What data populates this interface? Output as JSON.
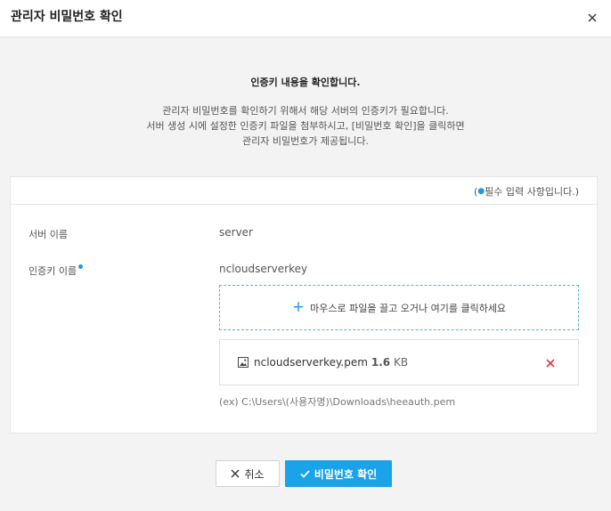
{
  "dialog": {
    "title": "관리자 비밀번호 확인",
    "close_icon": "close-icon"
  },
  "intro": {
    "heading": "인증키 내용을 확인합니다.",
    "lines": [
      "관리자 비밀번호를 확인하기 위해서 해당 서버의 인증키가 필요합니다.",
      "서버 생성 시에 설정한 인증키 파일을 첨부하시고, [비밀번호 확인]을 클릭하면",
      "관리자 비밀번호가 제공됩니다."
    ]
  },
  "form": {
    "required_note_open": "(",
    "required_note_dot": "●",
    "required_note_text": "필수 입력 사항입니다.)",
    "server_name_label": "서버 이름",
    "server_name_value": "server",
    "auth_key_label": "인증키 이름",
    "auth_key_value": "ncloudserverkey",
    "dropzone_text": "마우스로 파일을 끌고 오거나 여기를 클릭하세요",
    "file": {
      "icon": "image-file-icon",
      "name": "ncloudserverkey.pem",
      "size": "1.6",
      "unit": "KB"
    },
    "example": "(ex) C:\\Users\\(사용자명)\\Downloads\\heeauth.pem"
  },
  "buttons": {
    "cancel_label": "취소",
    "confirm_label": "비밀번호 확인"
  },
  "colors": {
    "accent": "#1aa3e8",
    "remove": "#e0393e",
    "required_dot": "#1a9be6"
  }
}
